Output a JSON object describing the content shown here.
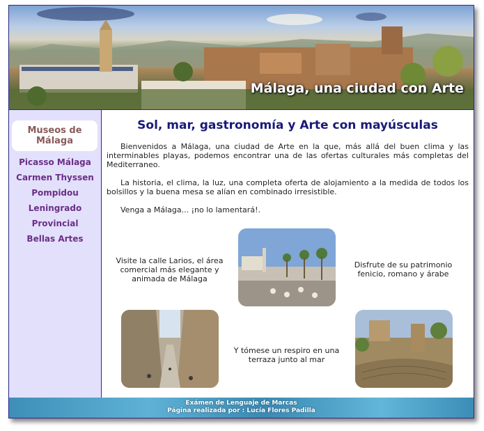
{
  "header": {
    "title": "Málaga, una ciudad con Arte"
  },
  "sidebar": {
    "box_title_line1": "Museos de",
    "box_title_line2": "Málaga",
    "links": [
      "Picasso Málaga",
      "Carmen Thyssen",
      "Pompidou",
      "Leningrado",
      "Provincial",
      "Bellas Artes"
    ]
  },
  "main": {
    "title": "Sol, mar, gastronomía y Arte con mayúsculas",
    "paragraphs": [
      "Bienvenidos a Málaga, una ciudad de Arte en la que, más allá del buen clima y las interminables playas, podemos encontrar una de las ofertas culturales más completas del Mediterraneo.",
      "La historia, el clima, la luz, una completa oferta de alojamiento a la medida de todos los bolsillos y la buena mesa se alían en combinado irresistible.",
      "Venga a Málaga... ¡no lo lamentará!."
    ],
    "captions": [
      "Visite la calle Larios, el área comercial más elegante y animada de Málaga",
      "Disfrute de su patrimonio fenicio, romano y árabe",
      "Y tómese un respiro en una terraza junto al mar"
    ]
  },
  "footer": {
    "line1": "Exámen de Lenguaje de Marcas",
    "line2": "Página realizada por : Lucía Flores Padilla"
  }
}
